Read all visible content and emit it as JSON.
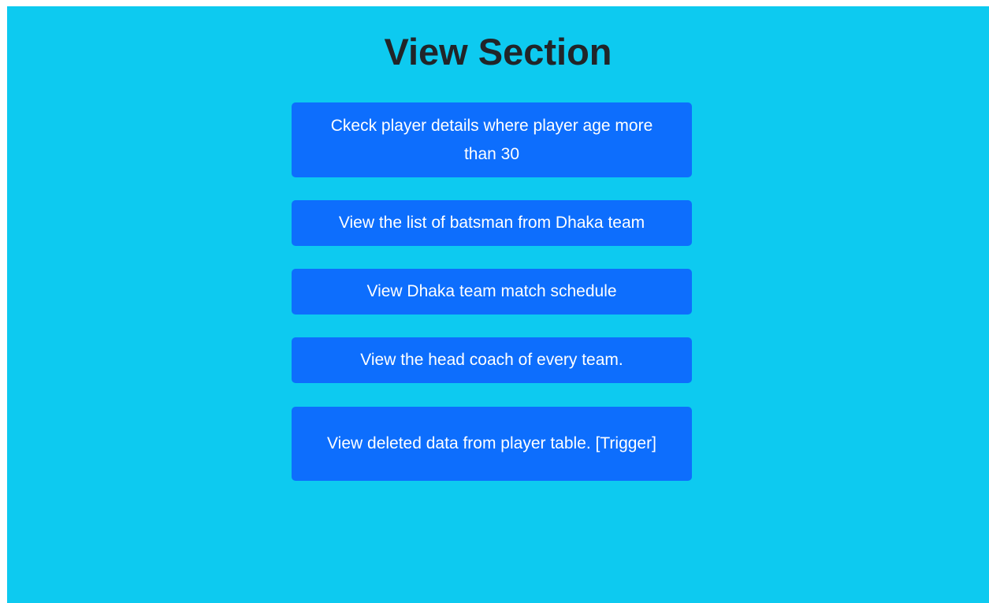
{
  "page": {
    "title": "View Section",
    "background_color": "#0dcaf0",
    "button_color": "#0d6efd"
  },
  "buttons": [
    {
      "label": "Ckeck player details where player age more than 30"
    },
    {
      "label": "View the list of batsman from Dhaka team"
    },
    {
      "label": "View Dhaka team match schedule"
    },
    {
      "label": "View the head coach of every team."
    },
    {
      "label": "View deleted data from player table. [Trigger]"
    }
  ]
}
